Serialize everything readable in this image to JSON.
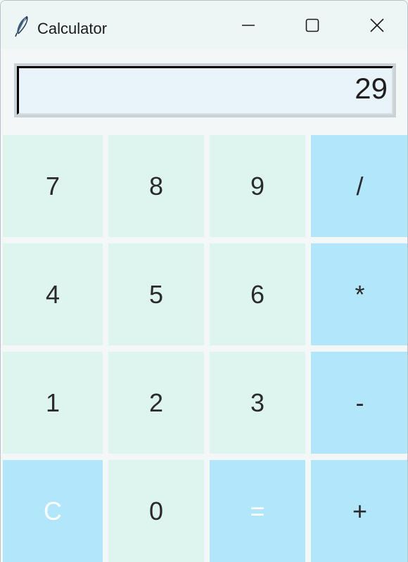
{
  "window": {
    "title": "Calculator",
    "icon": "feather-icon",
    "controls": {
      "minimize": "minimize-icon",
      "maximize": "maximize-icon",
      "close": "close-icon"
    }
  },
  "display": {
    "value": "29"
  },
  "keys": {
    "k7": "7",
    "k8": "8",
    "k9": "9",
    "div": "/",
    "k4": "4",
    "k5": "5",
    "k6": "6",
    "mul": "*",
    "k1": "1",
    "k2": "2",
    "k3": "3",
    "sub": "-",
    "clear": "C",
    "k0": "0",
    "equals": "=",
    "add": "+"
  },
  "colors": {
    "number_key": "#def5ef",
    "operator_key": "#b1e6fb",
    "display_bg": "#e8f4f9",
    "titlebar_bg": "#eef5f5"
  }
}
